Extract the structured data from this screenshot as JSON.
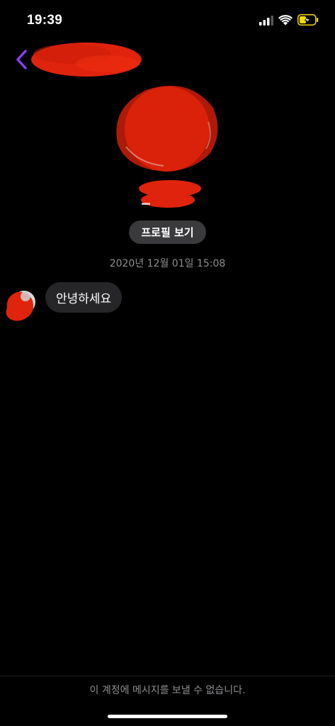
{
  "status_bar": {
    "time": "19:39",
    "icons": [
      "cellular-signal-icon",
      "wifi-icon",
      "battery-charging-icon"
    ],
    "battery_color": "#f5d90a"
  },
  "nav": {
    "back_icon": "chevron-left-icon",
    "accent_color": "#8a3ffc"
  },
  "profile": {
    "view_profile_label": "프로필 보기"
  },
  "conversation": {
    "timestamp": "2020년 12월 01일 15:08",
    "messages": [
      {
        "text": "안녕하세요"
      }
    ]
  },
  "footer": {
    "notice": "이 계정에 메시지를 보낼 수 없습니다."
  },
  "colors": {
    "background": "#000000",
    "bubble": "#262629",
    "secondary_text": "#8e8e93",
    "redaction": "#e0230c"
  }
}
